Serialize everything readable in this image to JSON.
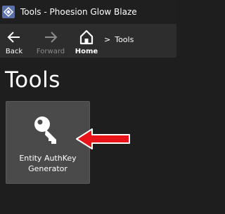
{
  "window": {
    "title": "Tools - Phoesion Glow Blaze",
    "app_icon": "phoesion-logo-icon"
  },
  "toolbar": {
    "back_label": "Back",
    "forward_label": "Forward",
    "home_label": "Home",
    "breadcrumb_separator": ">",
    "breadcrumb_current": "Tools"
  },
  "page": {
    "title": "Tools"
  },
  "tools": [
    {
      "label_line1": "Entity AuthKey",
      "label_line2": "Generator",
      "icon": "key-icon"
    }
  ],
  "annotation": {
    "icon": "red-arrow-icon",
    "color": "#e8141a"
  },
  "colors": {
    "title_bar": "#1f1f1f",
    "toolbar": "#2d2d2d",
    "background": "#1e1e1e",
    "tile": "#4a4a4a",
    "disabled_text": "#8c8c8c"
  }
}
